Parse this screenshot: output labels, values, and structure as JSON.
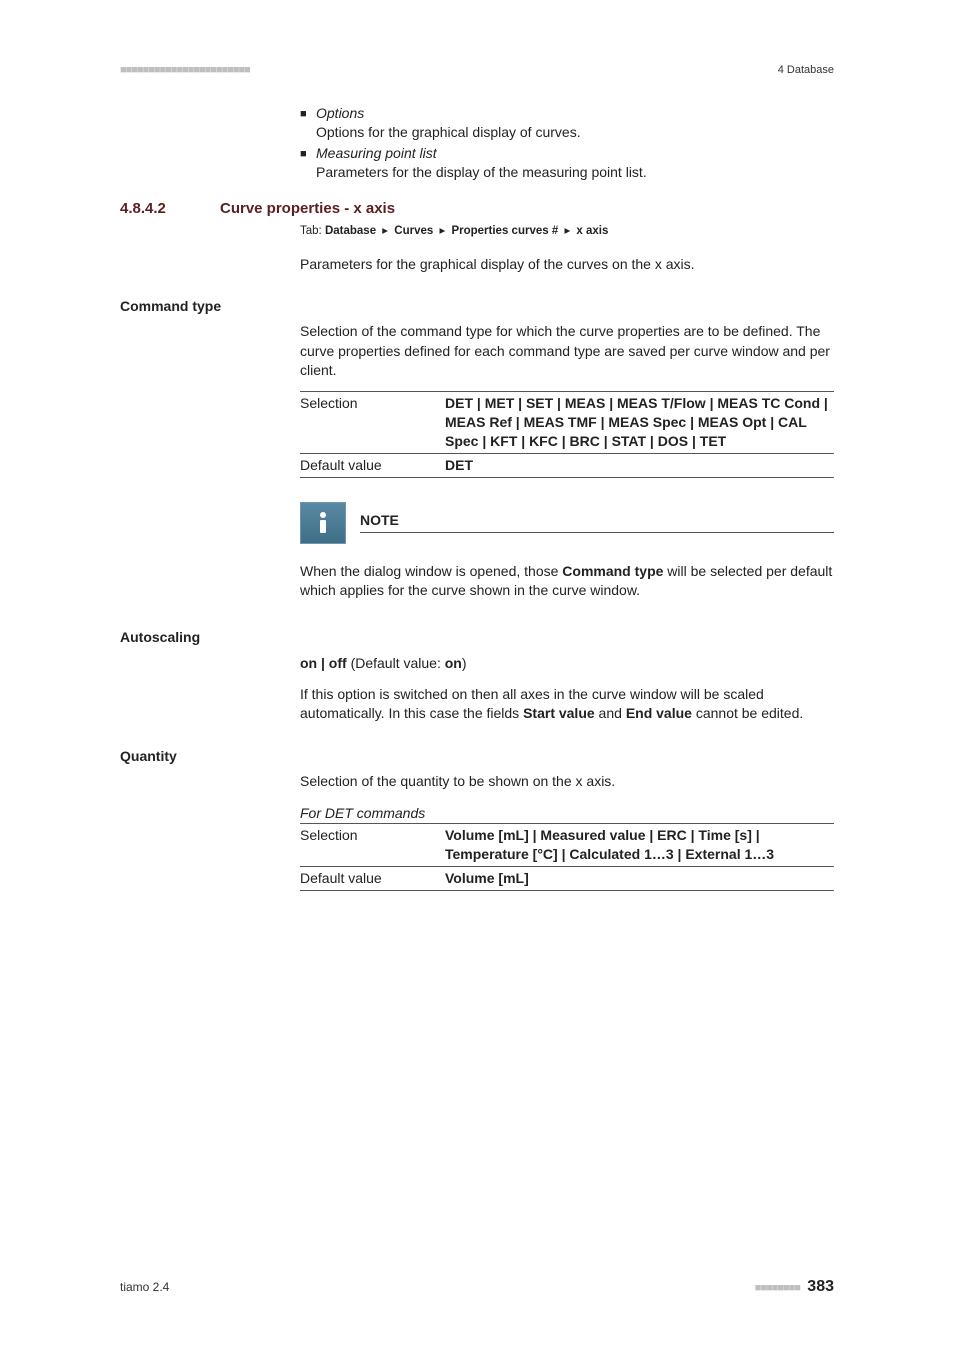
{
  "header": {
    "stripes": "■■■■■■■■■■■■■■■■■■■■■■■",
    "right": "4 Database"
  },
  "bullets": [
    {
      "name": "Options",
      "desc": "Options for the graphical display of curves."
    },
    {
      "name": "Measuring point list",
      "desc": "Parameters for the display of the measuring point list."
    }
  ],
  "section": {
    "num": "4.8.4.2",
    "title": "Curve properties - x axis",
    "tab_label": "Tab:",
    "tab_path": [
      "Database",
      "Curves",
      "Properties curves #",
      "x axis"
    ],
    "intro": "Parameters for the graphical display of the curves on the x axis."
  },
  "command_type": {
    "heading": "Command type",
    "desc": "Selection of the command type for which the curve properties are to be defined. The curve properties defined for each command type are saved per curve window and per client.",
    "selection_label": "Selection",
    "selection_value": "DET | MET | SET | MEAS | MEAS T/Flow | MEAS TC Cond | MEAS Ref | MEAS TMF | MEAS Spec | MEAS Opt | CAL Spec | KFT | KFC | BRC | STAT | DOS | TET",
    "default_label": "Default value",
    "default_value": "DET"
  },
  "note": {
    "title": "NOTE",
    "body_pre": "When the dialog window is opened, those ",
    "body_bold": "Command type",
    "body_post": " will be selected per default which applies for the curve shown in the curve window."
  },
  "autoscaling": {
    "heading": "Autoscaling",
    "line_pre": "on | off",
    "line_mid": " (Default value: ",
    "line_bold": "on",
    "line_end": ")",
    "desc_pre": "If this option is switched on then all axes in the curve window will be scaled automatically. In this case the fields ",
    "desc_b1": "Start value",
    "desc_mid": " and ",
    "desc_b2": "End value",
    "desc_post": " cannot be edited."
  },
  "quantity": {
    "heading": "Quantity",
    "desc": "Selection of the quantity to be shown on the x axis.",
    "for_label": "For DET commands",
    "selection_label": "Selection",
    "selection_value": "Volume [mL] | Measured value | ERC | Time [s] | Temperature [°C] | Calculated 1…3 | External 1…3",
    "default_label": "Default value",
    "default_value": "Volume [mL]"
  },
  "footer": {
    "left": "tiamo 2.4",
    "stripes": "■■■■■■■■",
    "page": "383"
  }
}
